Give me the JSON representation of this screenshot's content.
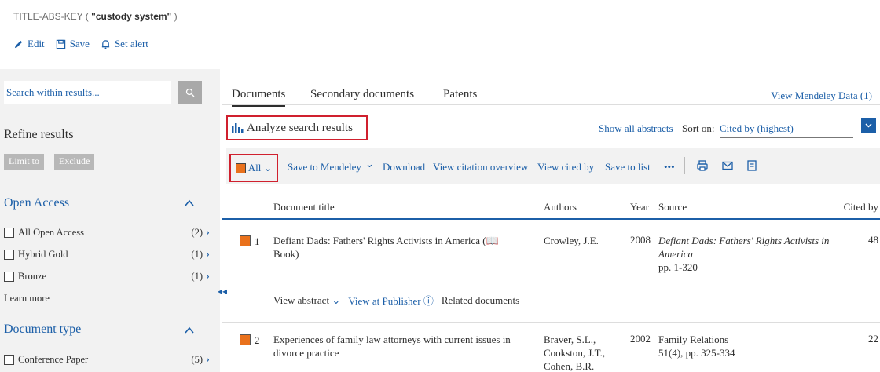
{
  "query": {
    "prefix": "TITLE-ABS-KEY ( ",
    "term": "\"custody system\"",
    "suffix": " )"
  },
  "actions": {
    "edit": "Edit",
    "save": "Save",
    "alert": "Set alert"
  },
  "sidebar": {
    "search_placeholder": "Search within results...",
    "refine": "Refine results",
    "limit": "Limit to",
    "exclude": "Exclude",
    "open_access": {
      "title": "Open Access",
      "items": [
        {
          "label": "All Open Access",
          "count": "(2)"
        },
        {
          "label": "Hybrid Gold",
          "count": "(1)"
        },
        {
          "label": "Bronze",
          "count": "(1)"
        }
      ],
      "learn_more": "Learn more"
    },
    "doc_type": {
      "title": "Document type",
      "items": [
        {
          "label": "Conference Paper",
          "count": "(5)"
        }
      ]
    }
  },
  "tabs": {
    "documents": "Documents",
    "secondary": "Secondary documents",
    "patents": "Patents",
    "mendeley": "View Mendeley Data (1)"
  },
  "analyze": "Analyze search results",
  "sort": {
    "show_all": "Show all abstracts",
    "label": "Sort on:",
    "value": "Cited by (highest)"
  },
  "toolbar": {
    "all": "All",
    "save_mendeley": "Save to Mendeley",
    "download": "Download",
    "citation": "View citation overview",
    "cited_by": "View cited by",
    "save_list": "Save to list",
    "more": "•••"
  },
  "table": {
    "headers": {
      "title": "Document title",
      "authors": "Authors",
      "year": "Year",
      "source": "Source",
      "cited": "Cited by"
    },
    "rows": [
      {
        "num": "1",
        "title": "Defiant Dads: Fathers' Rights Activists in America (",
        "title_tail": " Book)",
        "authors": "Crowley, J.E.",
        "year": "2008",
        "source": "Defiant Dads: Fathers' Rights Activists in America",
        "pages": "pp. 1-320",
        "cited": "48"
      },
      {
        "num": "2",
        "title": "Experiences of family law attorneys with current issues in divorce practice",
        "authors": "Braver, S.L., Cookston, J.T., Cohen, B.R.",
        "year": "2002",
        "source": "Family Relations",
        "pages": "51(4), pp. 325-334",
        "cited": "22"
      }
    ],
    "row_links": {
      "abstract": "View abstract",
      "publisher": "View at Publisher",
      "related": "Related documents"
    }
  },
  "colors": {
    "link": "#1c5fa8",
    "highlight": "#d0202e",
    "checkbox": "#e9711c"
  }
}
